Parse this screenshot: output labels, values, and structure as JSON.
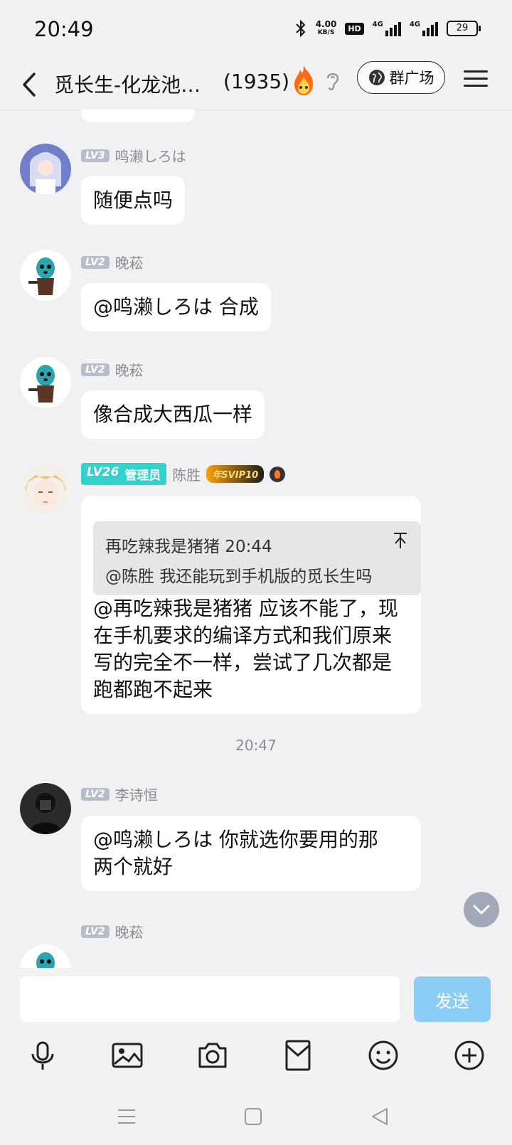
{
  "status_bar": {
    "time": "20:49",
    "net_speed_value": "4.00",
    "net_speed_unit": "KB/S",
    "hd_label": "HD",
    "signal_1_tag": "4G",
    "signal_2_tag": "4G",
    "battery": "29"
  },
  "header": {
    "title": "觅长生-化龙池…",
    "member_count": "(1935)",
    "plaza_label": "群广场"
  },
  "messages": [
    {
      "level": "LV3",
      "name": "鸣濑しろは",
      "text": "随便点吗"
    },
    {
      "level": "LV2",
      "name": "晚菘",
      "text": "@鸣濑しろは 合成"
    },
    {
      "level": "LV2",
      "name": "晚菘",
      "text": "像合成大西瓜一样"
    },
    {
      "level": "LV26",
      "role": "管理员",
      "name": "陈胜",
      "vip": "年SVIP10",
      "quote_author": "再吃辣我是猪猪 20:44",
      "quote_text": "@陈胜 我还能玩到手机版的觅长生吗",
      "text_lines": [
        "@再吃辣我是猪猪 应该不能了，现",
        "在手机要求的编译方式和我们原来",
        "写的完全不一样，尝试了几次都是",
        "跑都跑不起来"
      ]
    },
    {
      "timestamp": "20:47"
    },
    {
      "level": "LV2",
      "name": "李诗恒",
      "text_lines": [
        "@鸣濑しろは 你就选你要用的那",
        "两个就好"
      ]
    },
    {
      "level": "LV2",
      "name": "晚菘"
    }
  ],
  "input": {
    "placeholder": "",
    "send_label": "发送"
  },
  "colors": {
    "background": "#f1f1f4",
    "admin_badge": "#31d2cd",
    "send_button": "#8ccdf6",
    "level_badge": "#b7bdc9"
  },
  "icons": {
    "toolbar": [
      "microphone-icon",
      "image-icon",
      "camera-icon",
      "red-envelope-icon",
      "emoji-icon",
      "plus-icon"
    ],
    "nav": [
      "menu-icon",
      "home-icon",
      "back-icon"
    ]
  }
}
